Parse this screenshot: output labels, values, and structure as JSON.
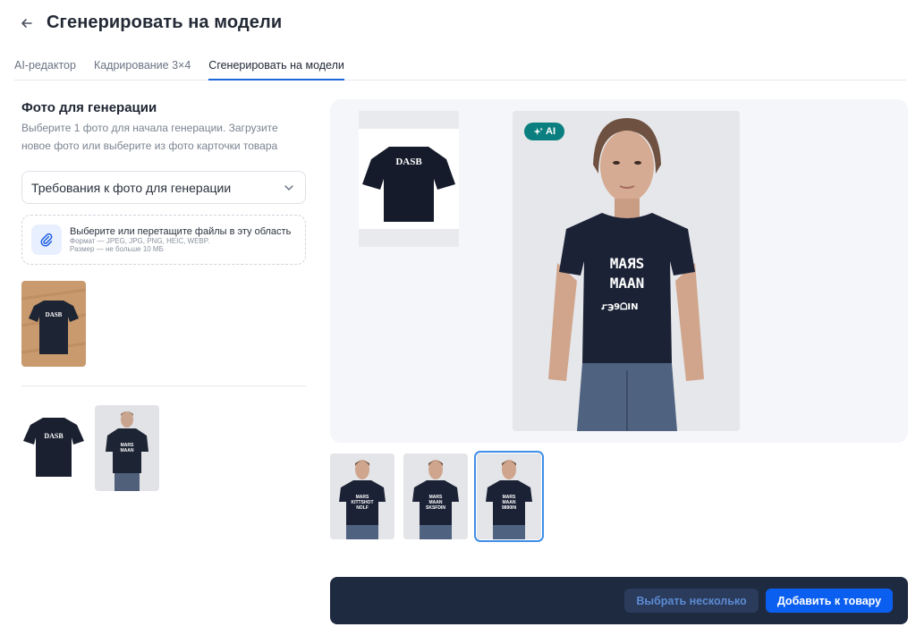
{
  "header": {
    "back_icon": "arrow-left-icon",
    "title": "Сгенерировать на модели"
  },
  "tabs": [
    {
      "label": "AI-редактор",
      "active": false
    },
    {
      "label": "Кадрирование 3×4",
      "active": false
    },
    {
      "label": "Сгенерировать на модели",
      "active": true
    }
  ],
  "left": {
    "section_title": "Фото для генерации",
    "section_desc": "Выберите 1 фото для начала генерации. Загрузите новое фото или выберите из фото карточки товара",
    "requirements_select": "Требования к фото для генерации",
    "upload": {
      "main": "Выберите или перетащите файлы в эту область",
      "format": "Формат — JPEG, JPG, PNG, HEIC, WEBP.",
      "size": "Размер — не больше 10 МБ"
    }
  },
  "images": {
    "uploaded_shirt_text": "DASB",
    "card_shirt_text": "DASB",
    "source_shirt_text": "DASB",
    "model_shirt_line1": "MAЯS",
    "model_shirt_line2": "MAAN",
    "model_shirt_line3": "ꭊ℈9ᗝIN"
  },
  "ai_badge": "AI",
  "footer": {
    "select_several": "Выбрать несколько",
    "add_to_product": "Добавить к товару"
  },
  "colors": {
    "accent": "#0b5ff0",
    "footer_bg": "#1e2a40",
    "ai_badge": "#0b7f7f"
  }
}
